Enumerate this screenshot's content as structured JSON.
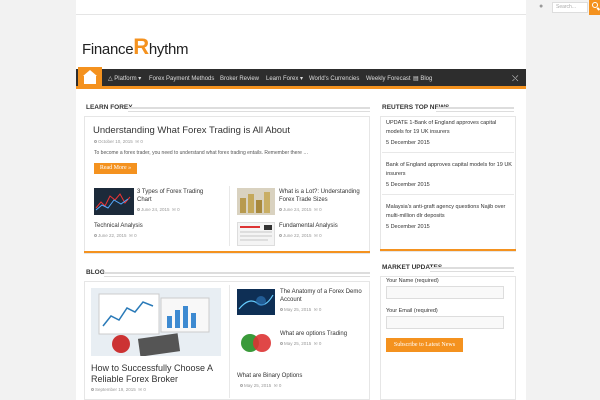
{
  "topbar": {
    "search_placeholder": "Search...",
    "twitter_icon": "twitter-icon"
  },
  "site": {
    "logo_prefix": "Finance",
    "logo_r": "R",
    "logo_suffix": "hythm"
  },
  "nav": {
    "items": [
      "Platform ▾",
      "Forex Payment Methods",
      "Broker Review",
      "Learn Forex ▾",
      "World's Currencies",
      "Weekly Forecast",
      "Blog"
    ]
  },
  "learn_forex": {
    "title": "LEARN FOREX",
    "featured": {
      "title": "Understanding What Forex Trading is All About",
      "date": "October 10, 2015",
      "comments": "0",
      "excerpt": "To become a forex trader, you need to understand what forex trading entails. Remember there …",
      "read_more": "Read More »"
    },
    "items": [
      {
        "title": "3 Types of Forex Trading Chart",
        "date": "June 24, 2015",
        "comments": "0"
      },
      {
        "title": "What is a Lot?: Understanding Forex Trade Sizes",
        "date": "June 24, 2015",
        "comments": "0"
      },
      {
        "title": "Technical Analysis",
        "date": "June 22, 2015",
        "comments": "0"
      },
      {
        "title": "Fundamental Analysis",
        "date": "June 22, 2015",
        "comments": "0"
      }
    ]
  },
  "blog": {
    "title": "BLOG",
    "featured": {
      "title": "How to Successfully Choose A Reliable Forex Broker",
      "date": "September 19, 2015",
      "comments": "0"
    },
    "items": [
      {
        "title": "The Anatomy of a Forex Demo Account",
        "date": "May 25, 2015",
        "comments": "0"
      },
      {
        "title": "What are options Trading",
        "date": "May 25, 2015",
        "comments": "0"
      },
      {
        "title": "What are Binary Options",
        "date": "May 25, 2015",
        "comments": "0"
      }
    ]
  },
  "reuters": {
    "title": "REUTERS TOP NEWS",
    "items": [
      {
        "text": "UPDATE 1-Bank of England approves capital models for 19 UK insurers",
        "date": "5 December 2015"
      },
      {
        "text": "Bank of England approves capital models for 19 UK insurers",
        "date": "5 December 2015"
      },
      {
        "text": "Malaysia's anti-graft agency questions Najib over multi-million dlr deposits",
        "date": "5 December 2015"
      }
    ]
  },
  "market_updates": {
    "title": "MARKET UPDATES",
    "name_label": "Your Name (required)",
    "email_label": "Your Email (required)",
    "subscribe": "Subscribe to Latest News"
  },
  "colors": {
    "accent": "#f4921f",
    "nav_bg": "#2d2d2d"
  }
}
